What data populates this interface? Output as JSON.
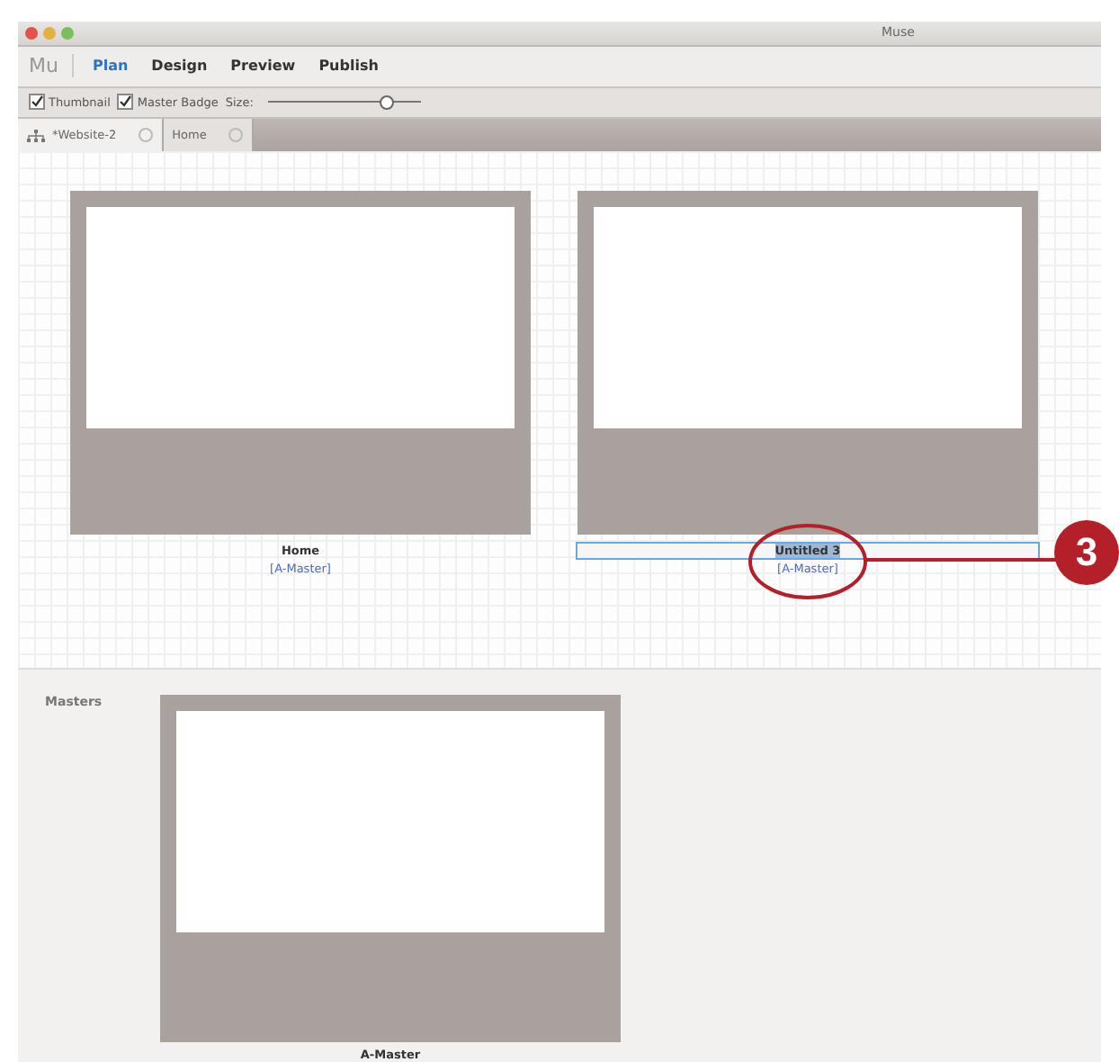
{
  "window": {
    "title": "Muse"
  },
  "logo": "Mu",
  "modes": [
    {
      "label": "Plan",
      "selected": true
    },
    {
      "label": "Design",
      "selected": false
    },
    {
      "label": "Preview",
      "selected": false
    },
    {
      "label": "Publish",
      "selected": false
    }
  ],
  "options": {
    "checkboxes": [
      {
        "label": "Thumbnail",
        "checked": true
      },
      {
        "label": "Master Badge",
        "checked": true
      }
    ],
    "size_label": "Size:",
    "size_slider": {
      "level": 0.78
    }
  },
  "tabs": [
    {
      "label": "*Website-2",
      "selected": true,
      "kind": "sitemap"
    },
    {
      "label": "Home",
      "selected": false,
      "kind": "page"
    }
  ],
  "pages": [
    {
      "name": "Home",
      "master": "[A-Master]",
      "editing": false
    },
    {
      "name": "Untitled 3",
      "master": "[A-Master]",
      "editing": true
    }
  ],
  "masters": {
    "label": "Masters",
    "items": [
      {
        "name": "A-Master"
      }
    ]
  },
  "callout": {
    "number": "3"
  }
}
